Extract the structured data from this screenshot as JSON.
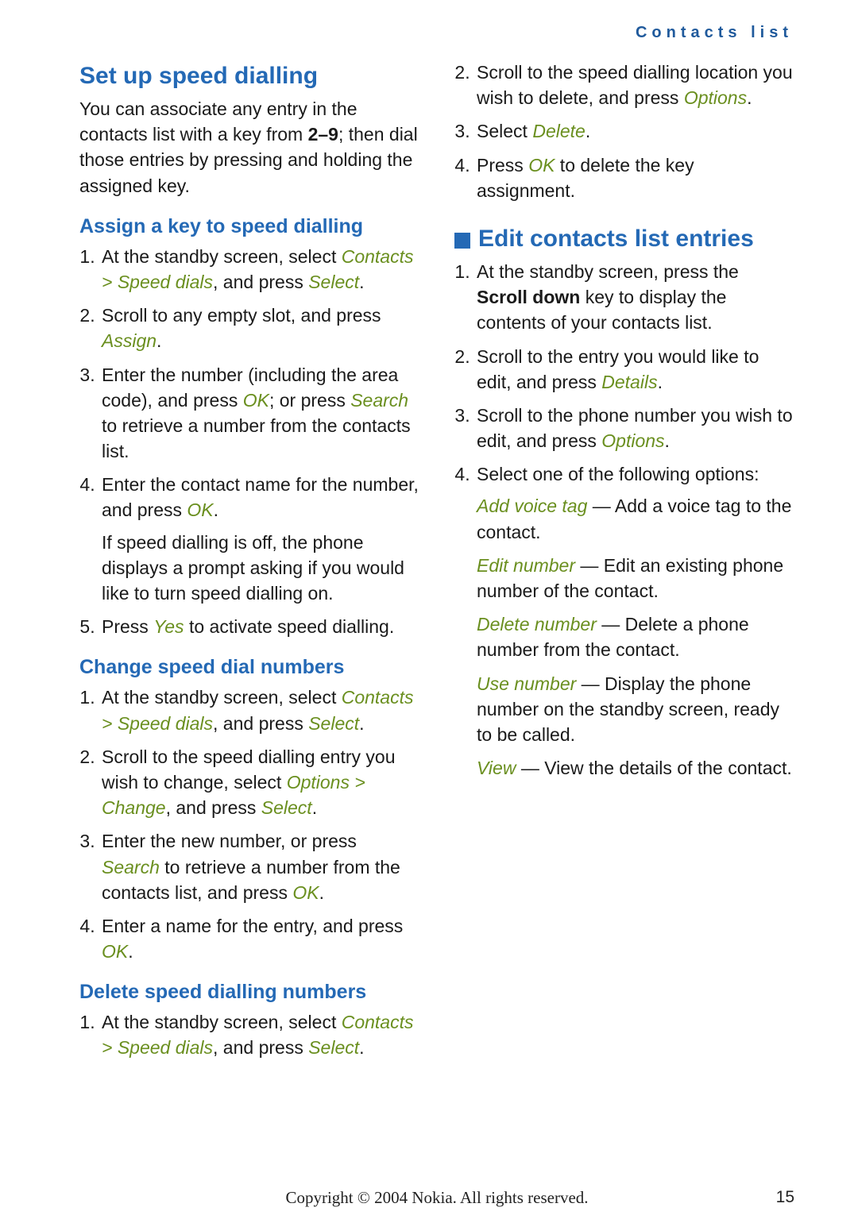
{
  "running_head": "Contacts list",
  "footer": {
    "copyright": "Copyright © 2004 Nokia. All rights reserved.",
    "page_number": "15"
  },
  "speed_dial": {
    "heading": "Set up speed dialling",
    "intro_pre": "You can associate any entry in the contacts list with a key from ",
    "intro_range": "2–9",
    "intro_post": "; then dial those entries by pressing and holding the assigned key.",
    "assign": {
      "heading": "Assign a key to speed dialling",
      "s1_pre": "At the standby screen, select ",
      "s1_path": "Contacts > Speed dials",
      "s1_mid": ", and press ",
      "s1_key": "Select",
      "s1_post": ".",
      "s2_pre": "Scroll to any empty slot, and press ",
      "s2_key": "Assign",
      "s2_post": ".",
      "s3_pre": "Enter the number (including the area code), and press ",
      "s3_key1": "OK",
      "s3_mid": "; or press ",
      "s3_key2": "Search",
      "s3_post": " to retrieve a number from the contacts list.",
      "s4_pre": "Enter the contact name for the number, and press ",
      "s4_key": "OK",
      "s4_post": ".",
      "s4_note": "If speed dialling is off, the phone displays a prompt asking if you would like to turn speed dialling on.",
      "s5_pre": "Press ",
      "s5_key": "Yes",
      "s5_post": " to activate speed dialling."
    },
    "change": {
      "heading": "Change speed dial numbers",
      "s1_pre": "At the standby screen, select ",
      "s1_path": "Contacts > Speed dials",
      "s1_mid": ", and press ",
      "s1_key": "Select",
      "s1_post": ".",
      "s2_pre": "Scroll to the speed dialling entry you wish to change, select ",
      "s2_path": "Options > Change",
      "s2_mid": ", and press ",
      "s2_key": "Select",
      "s2_post": ".",
      "s3_pre": "Enter the new number, or press ",
      "s3_key1": "Search",
      "s3_mid": " to retrieve a number from the contacts list, and press ",
      "s3_key2": "OK",
      "s3_post": ".",
      "s4_pre": "Enter a name for the entry, and press ",
      "s4_key": "OK",
      "s4_post": "."
    },
    "del": {
      "heading": "Delete speed dialling numbers",
      "s1_pre": "At the standby screen, select ",
      "s1_path": "Contacts > Speed dials",
      "s1_mid": ", and press ",
      "s1_key": "Select",
      "s1_post": ".",
      "s2_pre": "Scroll to the speed dialling location you wish to delete, and press ",
      "s2_key": "Options",
      "s2_post": ".",
      "s3_pre": "Select ",
      "s3_key": "Delete",
      "s3_post": ".",
      "s4_pre": "Press ",
      "s4_key": "OK",
      "s4_post": " to delete the key assignment."
    }
  },
  "edit": {
    "heading": "Edit contacts list entries",
    "s1_pre": "At the standby screen, press the ",
    "s1_bold": "Scroll down",
    "s1_post": " key to display the contents of your contacts list.",
    "s2_pre": "Scroll to the entry you would like to edit, and press ",
    "s2_key": "Details",
    "s2_post": ".",
    "s3_pre": "Scroll to the phone number you wish to edit, and press ",
    "s3_key": "Options",
    "s3_post": ".",
    "s4": "Select one of the following options:",
    "opts": {
      "o1_lead": "Add voice tag",
      "o1_desc": " — Add a voice tag to the contact.",
      "o2_lead": "Edit number",
      "o2_desc": " — Edit an existing phone number of the contact.",
      "o3_lead": "Delete number",
      "o3_desc": " — Delete a phone number from the contact.",
      "o4_lead": "Use number",
      "o4_desc": " — Display the phone number on the standby screen, ready to be called.",
      "o5_lead": "View ",
      "o5_desc": " — View the details of the contact."
    }
  }
}
